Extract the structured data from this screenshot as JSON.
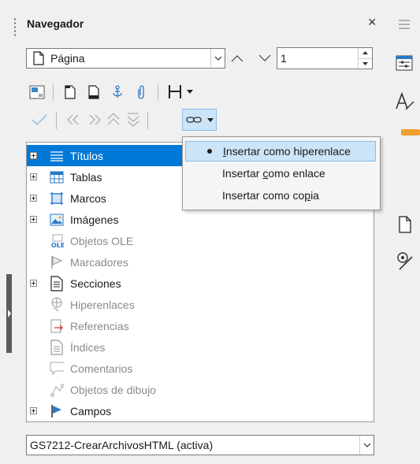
{
  "panel": {
    "title": "Navegador",
    "close_glyph": "×"
  },
  "nav_type": {
    "value": "Página",
    "page_number": "1"
  },
  "popup": {
    "items": [
      {
        "label": "Insertar como hiperenlace",
        "selected": true
      },
      {
        "label": "Insertar como enlace",
        "selected": false
      },
      {
        "label": "Insertar como copia",
        "selected": false
      }
    ]
  },
  "tree": {
    "items": [
      {
        "label": "Títulos",
        "expandable": true,
        "enabled": true,
        "selected": true,
        "icon": "headings-icon"
      },
      {
        "label": "Tablas",
        "expandable": true,
        "enabled": true,
        "selected": false,
        "icon": "tables-icon"
      },
      {
        "label": "Marcos",
        "expandable": true,
        "enabled": true,
        "selected": false,
        "icon": "frames-icon"
      },
      {
        "label": "Imágenes",
        "expandable": true,
        "enabled": true,
        "selected": false,
        "icon": "images-icon"
      },
      {
        "label": "Objetos OLE",
        "expandable": false,
        "enabled": false,
        "selected": false,
        "icon": "ole-objects-icon"
      },
      {
        "label": "Marcadores",
        "expandable": false,
        "enabled": false,
        "selected": false,
        "icon": "bookmarks-icon"
      },
      {
        "label": "Secciones",
        "expandable": true,
        "enabled": true,
        "selected": false,
        "icon": "sections-icon"
      },
      {
        "label": "Hiperenlaces",
        "expandable": false,
        "enabled": false,
        "selected": false,
        "icon": "hyperlinks-icon"
      },
      {
        "label": "Referencias",
        "expandable": false,
        "enabled": false,
        "selected": false,
        "icon": "references-icon"
      },
      {
        "label": "Índices",
        "expandable": false,
        "enabled": false,
        "selected": false,
        "icon": "indexes-icon"
      },
      {
        "label": "Comentarios",
        "expandable": false,
        "enabled": false,
        "selected": false,
        "icon": "comments-icon"
      },
      {
        "label": "Objetos de dibujo",
        "expandable": false,
        "enabled": false,
        "selected": false,
        "icon": "drawing-objects-icon"
      },
      {
        "label": "Campos",
        "expandable": true,
        "enabled": true,
        "selected": false,
        "icon": "fields-icon"
      }
    ]
  },
  "document": {
    "value": "GS7212-CrearArchivosHTML (activa)"
  },
  "colors": {
    "selection": "#0078d7",
    "popup_highlight": "#cce4f7",
    "disabled_text": "#8a8a8a"
  }
}
